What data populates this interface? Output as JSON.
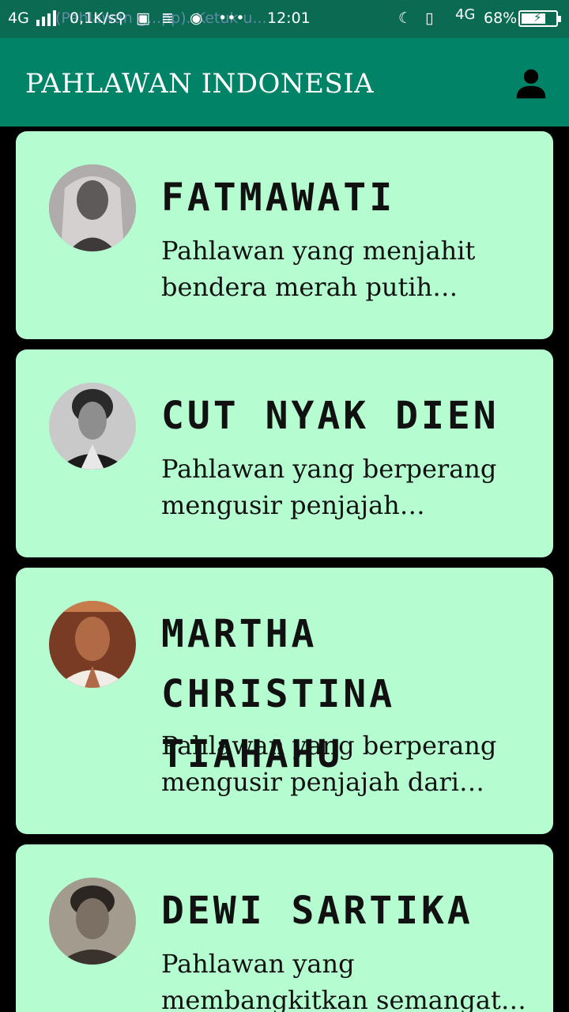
{
  "status_bar": {
    "network_left": "4G",
    "speed": "0,1K/s",
    "time": "12:01",
    "network_right": "4G",
    "battery": "68%",
    "bg_notification": "(Pahlawan g...pp). Ketuk u..."
  },
  "app": {
    "title": "PAHLAWAN INDONESIA",
    "profile_icon": "person-icon"
  },
  "heroes": [
    {
      "name": "FATMAWATI",
      "description": "Pahlawan yang menjahit bendera merah putih perta..."
    },
    {
      "name": "CUT NYAK DIEN",
      "description": "Pahlawan yang berperang mengusir penjajah Belanda..."
    },
    {
      "name": "MARTHA CHRISTINA TIAHAHU",
      "description": "Pahlawan yang berperang mengusir penjajah dari Mal..."
    },
    {
      "name": "DEWI SARTIKA",
      "description": "Pahlawan yang membangkitkan semangat k..."
    }
  ],
  "colors": {
    "status_bar": "#0b6a52",
    "app_bar": "#008367",
    "card": "#b5fcd0",
    "background": "#000000"
  }
}
